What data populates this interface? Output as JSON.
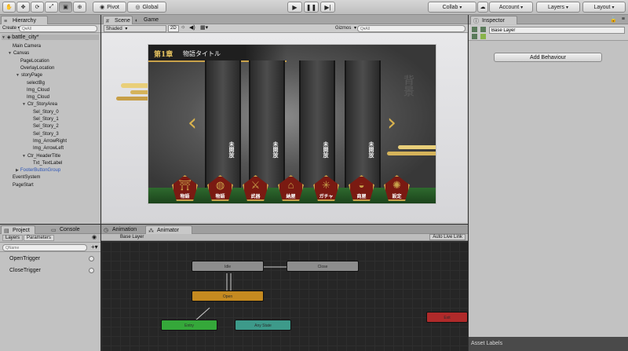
{
  "toolbar": {
    "pivot": "Pivot",
    "global": "Global",
    "collab": "Collab",
    "account": "Account",
    "layers": "Layers",
    "layout": "Layout",
    "tool_icons": [
      "hand-icon",
      "move-icon",
      "rotate-icon",
      "scale-icon",
      "rect-icon",
      "transform-icon"
    ],
    "play_icons": [
      "play-icon",
      "pause-icon",
      "step-icon"
    ]
  },
  "hierarchy": {
    "tab": "Hierarchy",
    "create": "Create",
    "search_placeholder": "Q▾All",
    "scene_name": "battle_city*",
    "items": [
      "Main Camera",
      "Canvas",
      "PageLocation",
      "OverlayLocation",
      "storyPage",
      "selectBg",
      "Img_Cloud",
      "Img_Cloud",
      "Ctr_StoryArea",
      "Sel_Story_0",
      "Sel_Story_1",
      "Sel_Story_2",
      "Sel_Story_3",
      "Img_ArrowRight",
      "Img_ArrowLeft",
      "Ctr_HeaderTitle",
      "Txt_TextLabel",
      "FooterButtonGroup",
      "EventSystem",
      "PageStart"
    ]
  },
  "scene": {
    "tabs": [
      "Scene",
      "Game"
    ],
    "shading": "Shaded",
    "mode_2d": "2D",
    "gizmos": "Gizmos",
    "search_placeholder": "Q▾All"
  },
  "game": {
    "chapter": "第1章",
    "title": "物語タイトル",
    "background_label": "背景",
    "story_labels": [
      "未開放",
      "未開放",
      "未開放",
      "未開放"
    ],
    "footer_buttons": [
      "物語",
      "物語",
      "武器",
      "納屋",
      "ガチャ",
      "商屋",
      "設定"
    ]
  },
  "inspector": {
    "tab": "Inspector",
    "object_name": "Base Layer",
    "add_behaviour": "Add Behaviour",
    "asset_labels": "Asset Labels"
  },
  "project": {
    "tabs": [
      "Project",
      "Console"
    ]
  },
  "animator": {
    "tabs": [
      "Animation",
      "Animator"
    ],
    "subtabs": [
      "Layers",
      "Parameters"
    ],
    "layer_name": "Base Layer",
    "auto_live_link": "Auto Live Link",
    "search_placeholder": "QName",
    "parameters": [
      "OpenTrigger",
      "CloseTrigger"
    ],
    "states": [
      "Idle",
      "Close",
      "Open",
      "Entry",
      "Any State",
      "Exit"
    ]
  },
  "colors": {
    "entry_state": "#35a83a",
    "any_state": "#3d9a8a",
    "exit_state": "#b02a2a",
    "open_state": "#c58a20",
    "default_state": "#8d8d8d",
    "gold": "#c9a24a",
    "footer_icon": "#7a1a12"
  }
}
